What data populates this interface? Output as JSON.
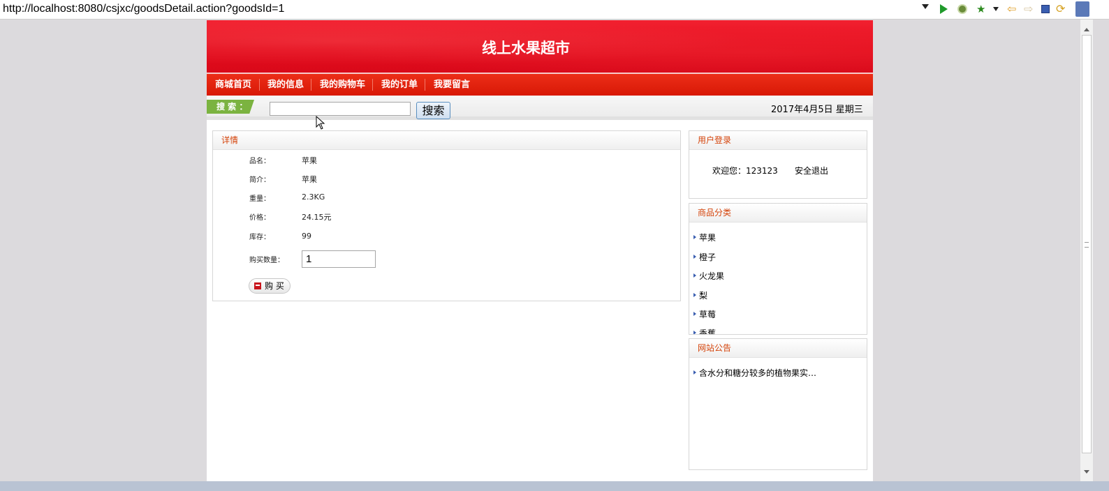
{
  "browser": {
    "url": "http://localhost:8080/csjxc/goodsDetail.action?goodsId=1"
  },
  "header": {
    "site_title": "线上水果超市"
  },
  "nav": {
    "items": [
      "商城首页",
      "我的信息",
      "我的购物车",
      "我的订单",
      "我要留言"
    ]
  },
  "search": {
    "label": "搜 索 ：",
    "input_value": "",
    "button_label": "搜索",
    "date_text": "2017年4月5日  星期三"
  },
  "detail": {
    "title": "详情",
    "fields": [
      {
        "label": "品名：",
        "value": "苹果"
      },
      {
        "label": "简介：",
        "value": "苹果"
      },
      {
        "label": "重量：",
        "value": "2.3KG"
      },
      {
        "label": "价格：",
        "value": "24.15元"
      },
      {
        "label": "库存：",
        "value": "99"
      }
    ],
    "qty_label": "购买数量：",
    "qty_value": "1",
    "buy_label": "购 买"
  },
  "login": {
    "title": "用户登录",
    "welcome": "欢迎您：123123",
    "logout": "安全退出"
  },
  "category": {
    "title": "商品分类",
    "items": [
      "苹果",
      "橙子",
      "火龙果",
      "梨",
      "草莓",
      "香蕉"
    ]
  },
  "notice": {
    "title": "网站公告",
    "items": [
      "含水分和糖分较多的植物果实…"
    ]
  },
  "colors": {
    "banner_red": "#e40b1c",
    "nav_red": "#d81806",
    "panel_title": "#d4430a",
    "search_tag_green": "#7bb340"
  }
}
